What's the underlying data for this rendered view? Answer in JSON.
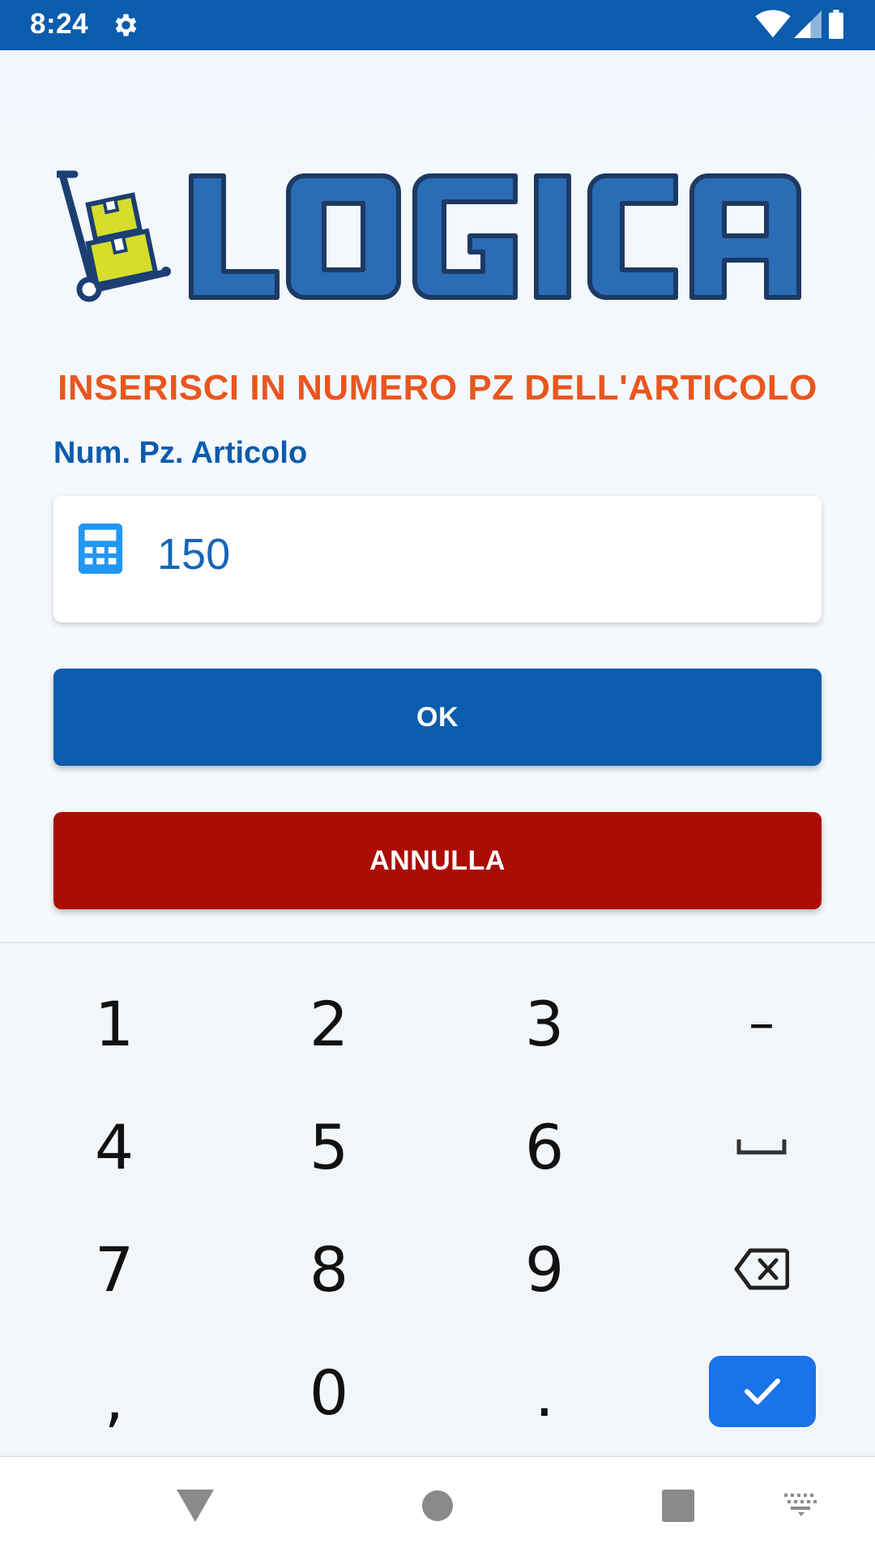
{
  "status_bar": {
    "time": "8:24",
    "icons": [
      "gear-icon",
      "wifi-icon",
      "signal-icon",
      "battery-icon"
    ]
  },
  "logo": {
    "text": "LOGICA",
    "icon": "hand-truck-boxes-icon"
  },
  "heading": "INSERISCI IN NUMERO PZ DELL'ARTICOLO",
  "field": {
    "label": "Num. Pz. Articolo",
    "value": "150",
    "icon": "calculator-icon"
  },
  "buttons": {
    "ok": "OK",
    "cancel": "ANNULLA"
  },
  "keyboard": {
    "rows": [
      [
        "1",
        "2",
        "3",
        "–"
      ],
      [
        "4",
        "5",
        "6",
        "space"
      ],
      [
        "7",
        "8",
        "9",
        "backspace"
      ],
      [
        ",",
        "0",
        ".",
        "enter"
      ]
    ],
    "space_glyph": "␣",
    "icons": [
      "space-icon",
      "backspace-icon",
      "check-icon"
    ]
  },
  "nav_bar": {
    "icons": [
      "back-icon",
      "home-icon",
      "recents-icon",
      "keyboard-switch-icon"
    ]
  },
  "colors": {
    "primary": "#0b5cad",
    "heading": "#e9561f",
    "cancel": "#ab0d04",
    "logo_yellow": "#d6dd2a",
    "enter_key": "#1a73e8"
  }
}
